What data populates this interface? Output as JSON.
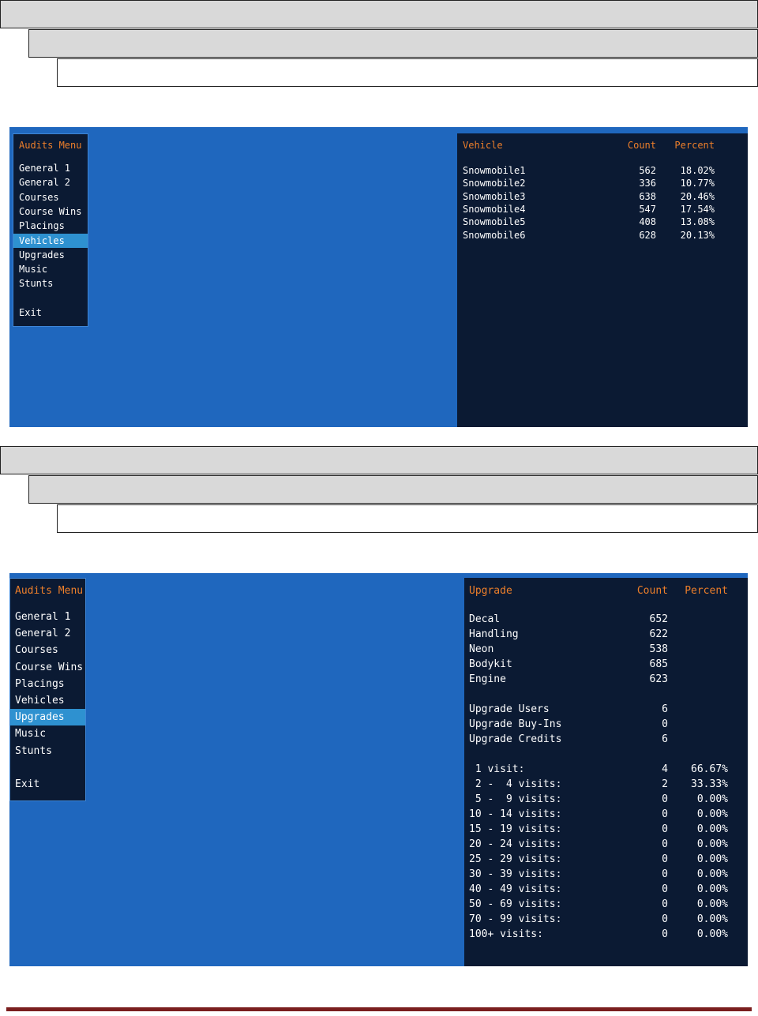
{
  "accent_color": "#ee7f2a",
  "screen_color": "#1f67be",
  "panel_color": "#0b1a33",
  "selected_color": "#2e91d0",
  "screen1": {
    "menu_title": "Audits Menu",
    "menu": [
      "General 1",
      "General 2",
      "Courses",
      "Course Wins",
      "Placings",
      "Vehicles",
      "Upgrades",
      "Music",
      "Stunts",
      "",
      "Exit"
    ],
    "selected": "Vehicles",
    "headers": {
      "name": "Vehicle",
      "count": "Count",
      "percent": "Percent"
    },
    "rows": [
      {
        "name": "Snowmobile1",
        "count": "562",
        "percent": "18.02%"
      },
      {
        "name": "Snowmobile2",
        "count": "336",
        "percent": "10.77%"
      },
      {
        "name": "Snowmobile3",
        "count": "638",
        "percent": "20.46%"
      },
      {
        "name": "Snowmobile4",
        "count": "547",
        "percent": "17.54%"
      },
      {
        "name": "Snowmobile5",
        "count": "408",
        "percent": "13.08%"
      },
      {
        "name": "Snowmobile6",
        "count": "628",
        "percent": "20.13%"
      }
    ]
  },
  "screen2": {
    "menu_title": "Audits Menu",
    "menu": [
      "General 1",
      "General 2",
      "Courses",
      "Course Wins",
      "Placings",
      "Vehicles",
      "Upgrades",
      "Music",
      "Stunts",
      "",
      "Exit"
    ],
    "selected": "Upgrades",
    "headers": {
      "name": "Upgrade",
      "count": "Count",
      "percent": "Percent"
    },
    "rows": [
      {
        "name": "Decal",
        "count": "652",
        "percent": ""
      },
      {
        "name": "Handling",
        "count": "622",
        "percent": ""
      },
      {
        "name": "Neon",
        "count": "538",
        "percent": ""
      },
      {
        "name": "Bodykit",
        "count": "685",
        "percent": ""
      },
      {
        "name": "Engine",
        "count": "623",
        "percent": ""
      },
      {
        "name": "",
        "count": "",
        "percent": ""
      },
      {
        "name": "Upgrade Users",
        "count": "6",
        "percent": ""
      },
      {
        "name": "Upgrade Buy-Ins",
        "count": "0",
        "percent": ""
      },
      {
        "name": "Upgrade Credits",
        "count": "6",
        "percent": ""
      },
      {
        "name": "",
        "count": "",
        "percent": ""
      },
      {
        "name": " 1 visit:",
        "count": "4",
        "percent": "66.67%"
      },
      {
        "name": " 2 -  4 visits:",
        "count": "2",
        "percent": "33.33%"
      },
      {
        "name": " 5 -  9 visits:",
        "count": "0",
        "percent": "0.00%"
      },
      {
        "name": "10 - 14 visits:",
        "count": "0",
        "percent": "0.00%"
      },
      {
        "name": "15 - 19 visits:",
        "count": "0",
        "percent": "0.00%"
      },
      {
        "name": "20 - 24 visits:",
        "count": "0",
        "percent": "0.00%"
      },
      {
        "name": "25 - 29 visits:",
        "count": "0",
        "percent": "0.00%"
      },
      {
        "name": "30 - 39 visits:",
        "count": "0",
        "percent": "0.00%"
      },
      {
        "name": "40 - 49 visits:",
        "count": "0",
        "percent": "0.00%"
      },
      {
        "name": "50 - 69 visits:",
        "count": "0",
        "percent": "0.00%"
      },
      {
        "name": "70 - 99 visits:",
        "count": "0",
        "percent": "0.00%"
      },
      {
        "name": "100+ visits:",
        "count": "0",
        "percent": "0.00%"
      }
    ]
  }
}
